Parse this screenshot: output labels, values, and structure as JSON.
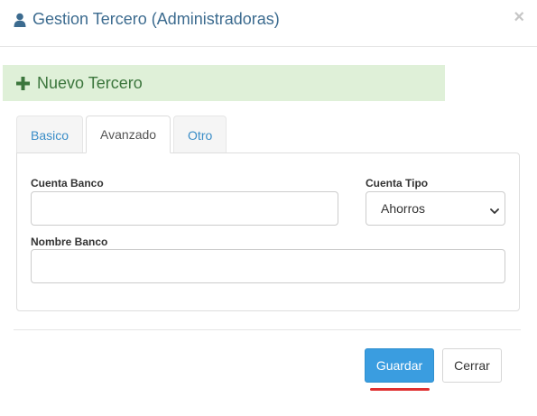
{
  "header": {
    "title": "Gestion Tercero (Administradoras)",
    "close_label": "×",
    "icon": "user-icon"
  },
  "banner": {
    "text": "Nuevo Tercero",
    "icon": "plus-icon",
    "color": "#3c763d"
  },
  "tabs": [
    {
      "label": "Basico",
      "active": false
    },
    {
      "label": "Avanzado",
      "active": true
    },
    {
      "label": "Otro",
      "active": false
    }
  ],
  "form": {
    "cuenta_banco": {
      "label": "Cuenta Banco",
      "value": ""
    },
    "cuenta_tipo": {
      "label": "Cuenta Tipo",
      "selected": "Ahorros"
    },
    "nombre_banco": {
      "label": "Nombre Banco",
      "value": ""
    }
  },
  "footer": {
    "save_label": "Guardar",
    "close_label": "Cerrar"
  },
  "colors": {
    "primary": "#3a9de0",
    "title": "#3c6b8f",
    "banner_bg": "#dff0d8",
    "underline": "#e03030"
  }
}
